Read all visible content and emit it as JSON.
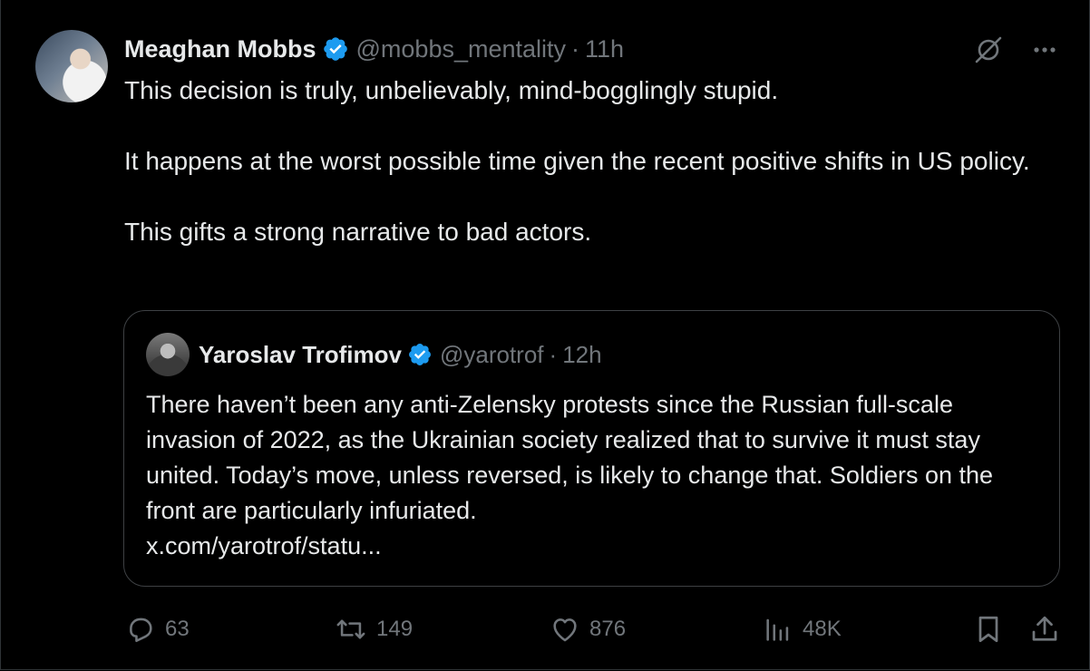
{
  "tweet": {
    "author_name": "Meaghan Mobbs",
    "handle": "@mobbs_mentality",
    "separator": "·",
    "time": "11h",
    "text": "This decision is truly, unbelievably, mind-bogglingly stupid.\n\nIt happens at the worst possible time given the recent positive shifts in US policy.\n\nThis gifts a strong narrative to bad actors."
  },
  "quoted_tweet": {
    "author_name": "Yaroslav Trofimov",
    "handle": "@yarotrof",
    "separator": "·",
    "time": "12h",
    "text": "There haven’t been any anti-Zelensky protests since the Russian full-scale invasion of 2022, as the Ukrainian society realized that to survive it must stay united. Today’s move, unless reversed, is likely to change that. Soldiers on the front are particularly infuriated.",
    "link": "x.com/yarotrof/statu..."
  },
  "actions": {
    "replies": "63",
    "reposts": "149",
    "likes": "876",
    "views": "48K"
  },
  "colors": {
    "background": "#000000",
    "text": "#e7e9ea",
    "muted": "#71767b",
    "verified": "#1d9bf0",
    "border": "#2f3336"
  },
  "icons": [
    "grok-icon",
    "more-icon",
    "reply-icon",
    "repost-icon",
    "like-icon",
    "views-icon",
    "bookmark-icon",
    "share-icon",
    "verified-badge-icon"
  ]
}
